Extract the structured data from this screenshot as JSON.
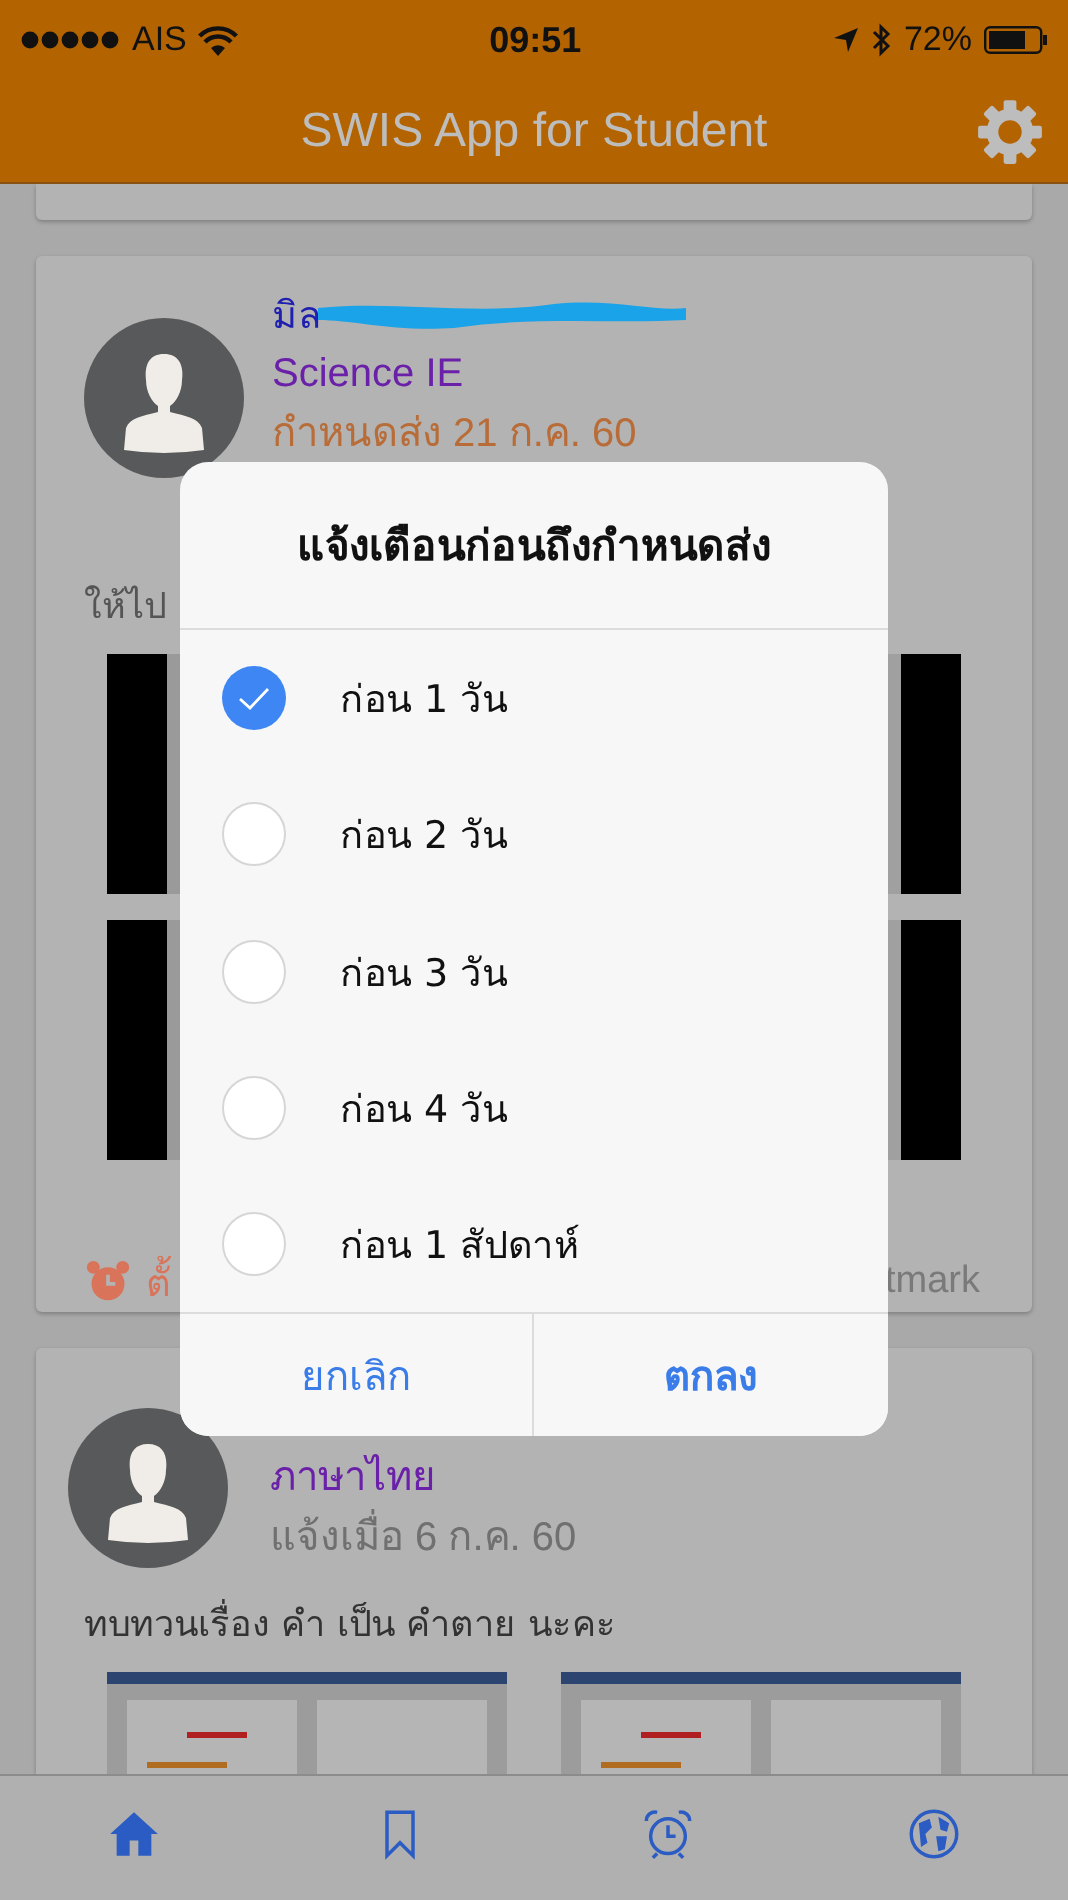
{
  "status_bar": {
    "carrier": "AIS",
    "time": "09:51",
    "battery": "72%"
  },
  "header": {
    "title": "SWIS App for Student"
  },
  "posts": [
    {
      "author": "มิล",
      "subject": "Science IE",
      "date": {
        "text": "กำหนดส่ง 21 ก.ค. 60",
        "kind": "due"
      },
      "message": "ให้ไป",
      "reminder": "ตั้",
      "bookmark": "tmark"
    },
    {
      "subject": "ภาษาไทย",
      "date": {
        "text": "แจ้งเมื่อ 6 ก.ค. 60",
        "kind": "notice"
      },
      "message": "ทบทวนเรื่อง คำ เป็น คำตาย นะคะ"
    }
  ],
  "dialog": {
    "title": "แจ้งเตือนก่อนถึงกำหนดส่ง",
    "options": [
      {
        "label": "ก่อน 1 วัน",
        "selected": true
      },
      {
        "label": "ก่อน 2 วัน",
        "selected": false
      },
      {
        "label": "ก่อน 3 วัน",
        "selected": false
      },
      {
        "label": "ก่อน 4 วัน",
        "selected": false
      },
      {
        "label": "ก่อน 1 สัปดาห์",
        "selected": false
      }
    ],
    "buttons": [
      {
        "label": "ยกเลิก",
        "kind": "cancel"
      },
      {
        "label": "ตกลง",
        "kind": "confirm"
      }
    ]
  },
  "tab_bar": {
    "tabs": [
      {
        "kind": "home"
      },
      {
        "kind": "bookmark"
      },
      {
        "kind": "alarm"
      },
      {
        "kind": "globe"
      }
    ]
  }
}
